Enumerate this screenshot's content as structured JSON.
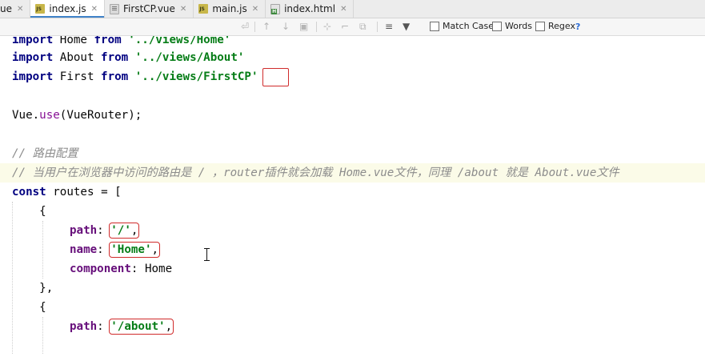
{
  "tabs": [
    {
      "label": "ue",
      "icon": "vue-file-icon",
      "active": false
    },
    {
      "label": "index.js",
      "icon": "js-file-icon",
      "active": true
    },
    {
      "label": "FirstCP.vue",
      "icon": "vue-file-icon",
      "active": false
    },
    {
      "label": "main.js",
      "icon": "js-file-icon",
      "active": false
    },
    {
      "label": "index.html",
      "icon": "html-file-icon",
      "active": false
    }
  ],
  "tab_close_glyph": "✕",
  "find": {
    "options": [
      "Match Case",
      "Words",
      "Regex"
    ],
    "help": "?"
  },
  "code": {
    "l0": {
      "kw": "import",
      "ident": " Home ",
      "kw2": "from",
      "str": "'../views/Home'"
    },
    "l1": {
      "kw": "import",
      "ident": " About ",
      "kw2": "from",
      "str": "'../views/About'"
    },
    "l2": {
      "kw": "import",
      "ident": " First ",
      "kw2": "from",
      "str": "'../views/FirstCP'"
    },
    "l4": {
      "obj": "Vue.",
      "fn": "use",
      "rest": "(VueRouter);"
    },
    "l6": {
      "cmt": "// 路由配置"
    },
    "l7": {
      "cmt": "// 当用户在浏览器中访问的路由是 / ，router插件就会加载 Home.vue文件，同理 /about 就是 About.vue文件"
    },
    "l8": {
      "kw": "const",
      "ident": " routes ",
      "rest": "= ["
    },
    "l9": {
      "text": "    {"
    },
    "l10": {
      "prop": "path",
      "colon": ": ",
      "str": "'/'",
      "comma": ","
    },
    "l11": {
      "prop": "name",
      "colon": ": ",
      "str": "'Home'",
      "comma": ","
    },
    "l12": {
      "prop": "component",
      "colon": ": ",
      "ident": "Home"
    },
    "l13": {
      "text": "    },"
    },
    "l14": {
      "text": "    {"
    },
    "l15": {
      "prop": "path",
      "colon": ": ",
      "str": "'/about'",
      "comma": ","
    }
  }
}
